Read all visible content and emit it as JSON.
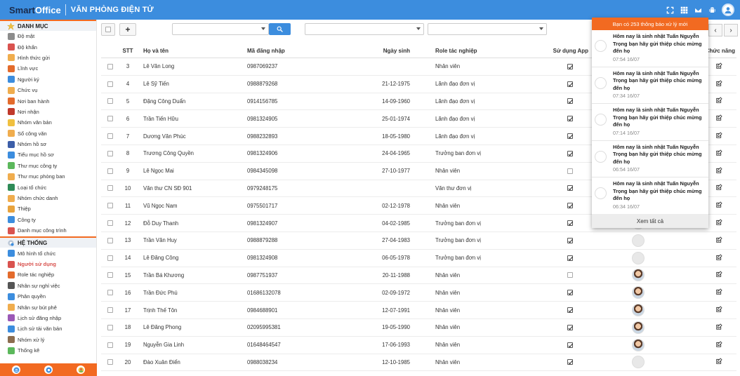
{
  "header": {
    "logo_smart": "Smart",
    "logo_office": "Office",
    "subtitle": "VĂN PHÒNG ĐIỆN TỬ",
    "icons": [
      "expand-icon",
      "grid-icon",
      "mail-icon",
      "android-icon",
      "user-avatar-icon"
    ]
  },
  "sidebar": {
    "section1": "DANH MỤC",
    "items1": [
      {
        "label": "Độ mật",
        "color": "#8c8c8c"
      },
      {
        "label": "Độ khẩn",
        "color": "#d9534f"
      },
      {
        "label": "Hình thức gửi",
        "color": "#f0ad4e"
      },
      {
        "label": "Lĩnh vực",
        "color": "#e36b2c"
      },
      {
        "label": "Người ký",
        "color": "#3c8dde"
      },
      {
        "label": "Chức vụ",
        "color": "#f0ad4e"
      },
      {
        "label": "Nơi ban hành",
        "color": "#e36b2c"
      },
      {
        "label": "Nơi nhận",
        "color": "#c0392b"
      },
      {
        "label": "Nhóm văn bản",
        "color": "#f0c040"
      },
      {
        "label": "Sổ công văn",
        "color": "#f0ad4e"
      },
      {
        "label": "Nhóm hồ sơ",
        "color": "#3c5ea8"
      },
      {
        "label": "Tiểu mục hồ sơ",
        "color": "#3c8dde"
      },
      {
        "label": "Thư mục công ty",
        "color": "#5cb85c"
      },
      {
        "label": "Thư mục phòng ban",
        "color": "#f0ad4e"
      },
      {
        "label": "Loại tổ chức",
        "color": "#2e8b57"
      },
      {
        "label": "Nhóm chức danh",
        "color": "#f0ad4e"
      },
      {
        "label": "Thiệp",
        "color": "#e8a33d"
      },
      {
        "label": "Công ty",
        "color": "#3c8dde"
      },
      {
        "label": "Danh mục công trình",
        "color": "#d9534f"
      }
    ],
    "section2": "HỆ THỐNG",
    "items2": [
      {
        "label": "Mô hình tổ chức",
        "color": "#3c8dde"
      },
      {
        "label": "Người sử dụng",
        "color": "#d9534f"
      },
      {
        "label": "Role tác nghiệp",
        "color": "#e36b2c"
      },
      {
        "label": "Nhân sự nghỉ việc",
        "color": "#555555"
      },
      {
        "label": "Phân quyền",
        "color": "#3c8dde"
      },
      {
        "label": "Nhân sự bút phê",
        "color": "#f0ad4e"
      },
      {
        "label": "Lịch sử đăng nhập",
        "color": "#9b59b6"
      },
      {
        "label": "Lịch sử tải văn bản",
        "color": "#3c8dde"
      },
      {
        "label": "Nhóm xử lý",
        "color": "#8c6d4f"
      },
      {
        "label": "Thống kê",
        "color": "#5cb85c"
      }
    ],
    "active_label": "Người sử dụng"
  },
  "toolbar": {
    "add_label": "+",
    "prev_label": "‹",
    "next_label": "›"
  },
  "table": {
    "headers": {
      "stt": "STT",
      "name": "Họ và tên",
      "login": "Mã đăng nhập",
      "dob": "Ngày sinh",
      "role": "Role tác nghiệp",
      "app": "Sử dụng App",
      "action": "Chức năng"
    },
    "rows": [
      {
        "stt": "3",
        "name": "Lê Văn Long",
        "login": "0987069237",
        "dob": "",
        "role": "Nhân viên",
        "app": true,
        "avatar": "blank"
      },
      {
        "stt": "4",
        "name": "Lê Sỹ Tiến",
        "login": "0988879268",
        "dob": "21-12-1975",
        "role": "Lãnh đạo đơn vị",
        "app": true,
        "avatar": "blank"
      },
      {
        "stt": "5",
        "name": "Đặng Công Duẩn",
        "login": "0914156785",
        "dob": "14-09-1960",
        "role": "Lãnh đạo đơn vị",
        "app": true,
        "avatar": "blank"
      },
      {
        "stt": "6",
        "name": "Trần Tiến Hữu",
        "login": "0981324905",
        "dob": "25-01-1974",
        "role": "Lãnh đạo đơn vị",
        "app": true,
        "avatar": "blank"
      },
      {
        "stt": "7",
        "name": "Dương Văn Phúc",
        "login": "0988232893",
        "dob": "18-05-1980",
        "role": "Lãnh đạo đơn vị",
        "app": true,
        "avatar": "blank"
      },
      {
        "stt": "8",
        "name": "Trương Công Quyền",
        "login": "0981324906",
        "dob": "24-04-1965",
        "role": "Trưởng ban đơn vị",
        "app": true,
        "avatar": "blank"
      },
      {
        "stt": "9",
        "name": "Lê Ngọc Mai",
        "login": "0984345098",
        "dob": "27-10-1977",
        "role": "Nhân viên",
        "app": false,
        "avatar": "blank"
      },
      {
        "stt": "10",
        "name": "Văn thư CN SĐ 901",
        "login": "0979248175",
        "dob": "",
        "role": "Văn thư đơn vị",
        "app": true,
        "avatar": "blank"
      },
      {
        "stt": "11",
        "name": "Vũ Ngọc Nam",
        "login": "0975501717",
        "dob": "02-12-1978",
        "role": "Nhân viên",
        "app": true,
        "avatar": "blank"
      },
      {
        "stt": "12",
        "name": "Đỗ Duy Thanh",
        "login": "0981324907",
        "dob": "04-02-1985",
        "role": "Trưởng ban đơn vị",
        "app": true,
        "avatar": "blank"
      },
      {
        "stt": "13",
        "name": "Trần Văn Huy",
        "login": "0988879288",
        "dob": "27-04-1983",
        "role": "Trưởng ban đơn vị",
        "app": true,
        "avatar": "blank"
      },
      {
        "stt": "14",
        "name": "Lê Đăng Công",
        "login": "0981324908",
        "dob": "06-05-1978",
        "role": "Trưởng ban đơn vị",
        "app": true,
        "avatar": "blank"
      },
      {
        "stt": "15",
        "name": "Trần Bá Khương",
        "login": "0987751937",
        "dob": "20-11-1988",
        "role": "Nhân viên",
        "app": false,
        "avatar": "photo"
      },
      {
        "stt": "16",
        "name": "Trần Đức Phú",
        "login": "01686132078",
        "dob": "02-09-1972",
        "role": "Nhân viên",
        "app": true,
        "avatar": "photo"
      },
      {
        "stt": "17",
        "name": "Trịnh Thế Tôn",
        "login": "0984688901",
        "dob": "12-07-1991",
        "role": "Nhân viên",
        "app": true,
        "avatar": "photo"
      },
      {
        "stt": "18",
        "name": "Lê Đăng Phong",
        "login": "02095995381",
        "dob": "19-05-1990",
        "role": "Nhân viên",
        "app": true,
        "avatar": "photo"
      },
      {
        "stt": "19",
        "name": "Nguyễn Gia Linh",
        "login": "01648464547",
        "dob": "17-06-1993",
        "role": "Nhân viên",
        "app": true,
        "avatar": "photo"
      },
      {
        "stt": "20",
        "name": "Đào Xuân Điển",
        "login": "0988038234",
        "dob": "12-10-1985",
        "role": "Nhân viên",
        "app": true,
        "avatar": "blank"
      }
    ]
  },
  "notifications": {
    "header": "Bạn có 253 thông báo xử lý mới",
    "items": [
      {
        "text": "Hôm nay là sinh nhật Tuấn Nguyễn Trọng bạn hãy gửi thiệp chúc mừng đến họ",
        "time": "07:54 16/07"
      },
      {
        "text": "Hôm nay là sinh nhật Tuấn Nguyễn Trọng bạn hãy gửi thiệp chúc mừng đến họ",
        "time": "07:34 16/07"
      },
      {
        "text": "Hôm nay là sinh nhật Tuấn Nguyễn Trọng bạn hãy gửi thiệp chúc mừng đến họ",
        "time": "07:14 16/07"
      },
      {
        "text": "Hôm nay là sinh nhật Tuấn Nguyễn Trọng bạn hãy gửi thiệp chúc mừng đến họ",
        "time": "06:54 16/07"
      },
      {
        "text": "Hôm nay là sinh nhật Tuấn Nguyễn Trọng bạn hãy gửi thiệp chúc mừng đến họ",
        "time": "06:34 16/07"
      }
    ],
    "footer": "Xem tất cả"
  },
  "colors": {
    "header_bg": "#3c8dde",
    "accent_orange": "#f26a21",
    "active_red": "#d9534f"
  }
}
